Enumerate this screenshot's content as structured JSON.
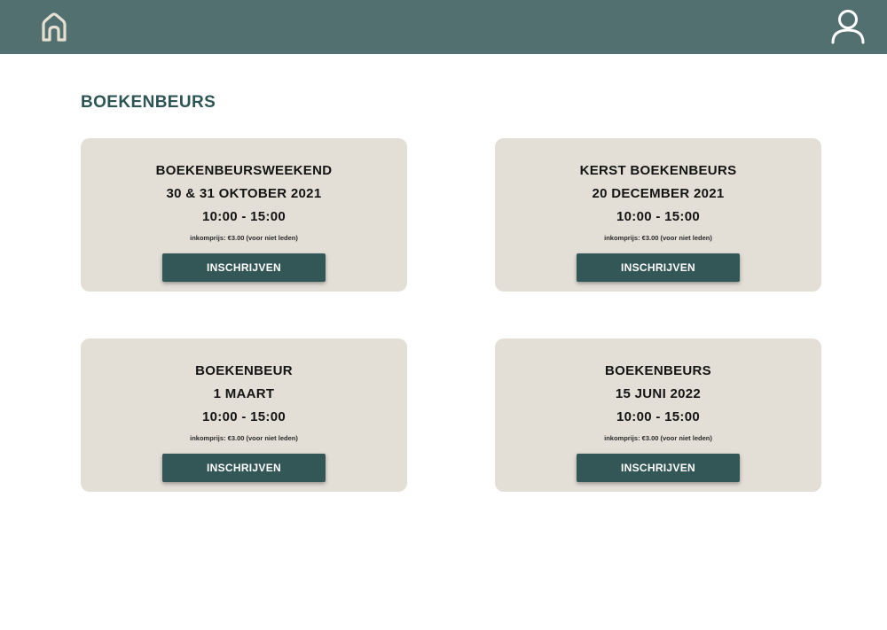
{
  "header": {
    "home_icon": "home-icon",
    "user_icon": "user-icon",
    "background_color": "#537071"
  },
  "page": {
    "title": "BOEKENBEURS"
  },
  "events": [
    {
      "title": "BOEKENBEURSWEEKEND",
      "date": "30 & 31 OKTOBER 2021",
      "time": "10:00 - 15:00",
      "price": "inkomprijs: €3.00 (voor niet leden)",
      "button": "INSCHRIJVEN"
    },
    {
      "title": "KERST BOEKENBEURS",
      "date": "20 DECEMBER 2021",
      "time": "10:00 - 15:00",
      "price": "inkomprijs: €3.00 (voor niet leden)",
      "button": "INSCHRIJVEN"
    },
    {
      "title": "BOEKENBEUR",
      "date": "1 MAART",
      "time": "10:00 - 15:00",
      "price": "inkomprijs: €3.00 (voor niet leden)",
      "button": "INSCHRIJVEN"
    },
    {
      "title": "BOEKENBEURS",
      "date": "15 JUNI 2022",
      "time": "10:00 - 15:00",
      "price": "inkomprijs: €3.00 (voor niet leden)",
      "button": "INSCHRIJVEN"
    }
  ],
  "colors": {
    "accent": "#325756",
    "card_background": "#e3dfd7",
    "title_color": "#2e5555"
  }
}
